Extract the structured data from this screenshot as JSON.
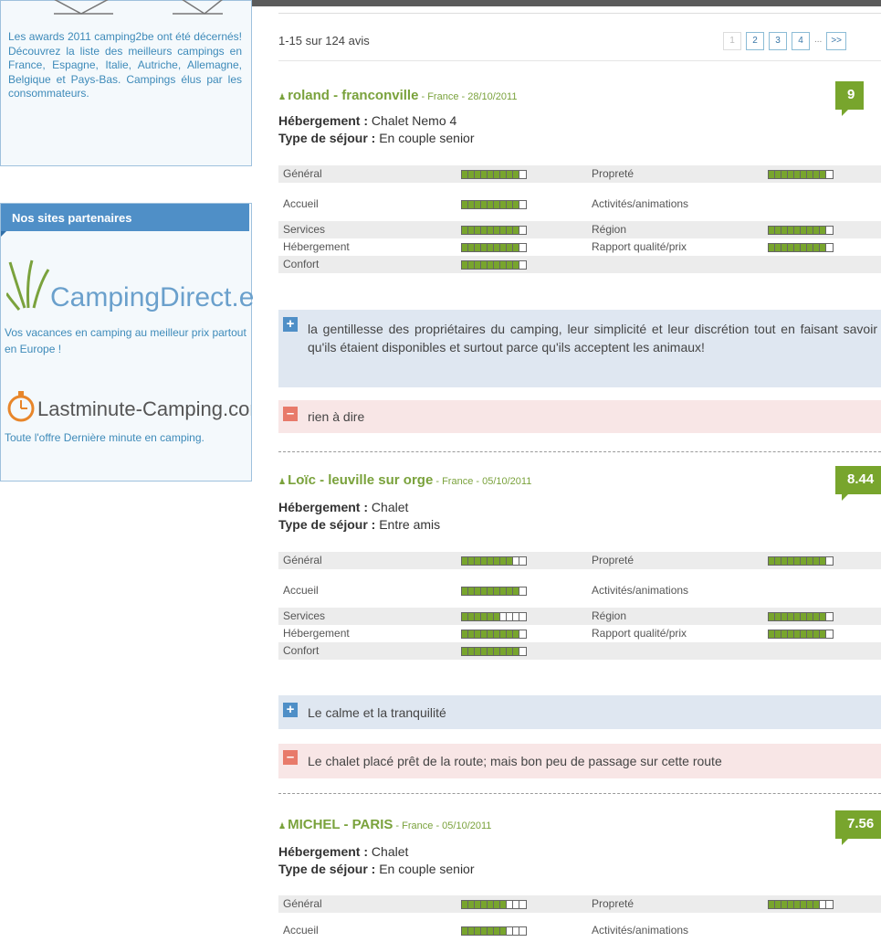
{
  "sidebar": {
    "awards_text": "Les awards 2011 camping2be ont été décernés! Découvrez la liste des meilleurs campings en France, Espagne, Italie, Autriche, Allemagne, Belgique et Pays-Bas. Campings élus par les consommateurs.",
    "partners_title": "Nos sites partenaires",
    "campingdirect_logo_text": "CampingDirect.eu",
    "campingdirect_text": "Vos vacances en camping au meilleur prix partout en Europe !",
    "lastminute_logo_text": "Lastminute-Camping.com",
    "lastminute_text": "Toute l'offre Dernière minute en camping."
  },
  "main": {
    "count_text": "1-15 sur 124 avis",
    "pager": [
      "1",
      "2",
      "3",
      "4",
      "...",
      ">>"
    ],
    "labels": {
      "hebergement": "Hébergement :",
      "type_sejour": "Type de séjour :"
    },
    "rating_labels": {
      "general": "Général",
      "proprete": "Propreté",
      "accueil": "Accueil",
      "activites": "Activités/animations",
      "services": "Services",
      "region": "Région",
      "hebergement": "Hébergement",
      "rapport": "Rapport qualité/prix",
      "confort": "Confort"
    },
    "reviews": [
      {
        "name": "roland - franconville",
        "meta": " - France - 28/10/2011",
        "score": "9",
        "hebergement": "Chalet Nemo 4",
        "type": "En couple senior",
        "ratings": {
          "general": 9,
          "proprete": 9,
          "accueil": 9,
          "activites": null,
          "services": 9,
          "region": 9,
          "hebergement": 9,
          "rapport": 9,
          "confort": 9
        },
        "positive": "la gentillesse des propriétaires du camping, leur simplicité et leur discrétion tout en faisant savoir qu'ils étaient disponibles et surtout parce qu'ils acceptent les animaux!",
        "negative": "rien à dire"
      },
      {
        "name": "Loïc - leuville sur orge",
        "meta": " - France - 05/10/2011",
        "score": "8.44",
        "hebergement": "Chalet",
        "type": "Entre amis",
        "ratings": {
          "general": 8,
          "proprete": 9,
          "accueil": 9,
          "activites": null,
          "services": 6,
          "region": 9,
          "hebergement": 9,
          "rapport": 9,
          "confort": 9
        },
        "positive": "Le calme et la tranquilité",
        "negative": "Le chalet placé prêt de la route; mais bon peu de passage sur cette route"
      },
      {
        "name": "MICHEL - PARIS",
        "meta": " - France - 05/10/2011",
        "score": "7.56",
        "hebergement": "Chalet",
        "type": "En couple senior",
        "ratings": {
          "general": 7,
          "proprete": 8,
          "accueil": 7,
          "activites": null
        },
        "positive": "",
        "negative": ""
      }
    ]
  },
  "colors": {
    "accent_green": "#78a52d",
    "link_blue": "#3d8ab9",
    "header_blue": "#4f8fc7"
  }
}
